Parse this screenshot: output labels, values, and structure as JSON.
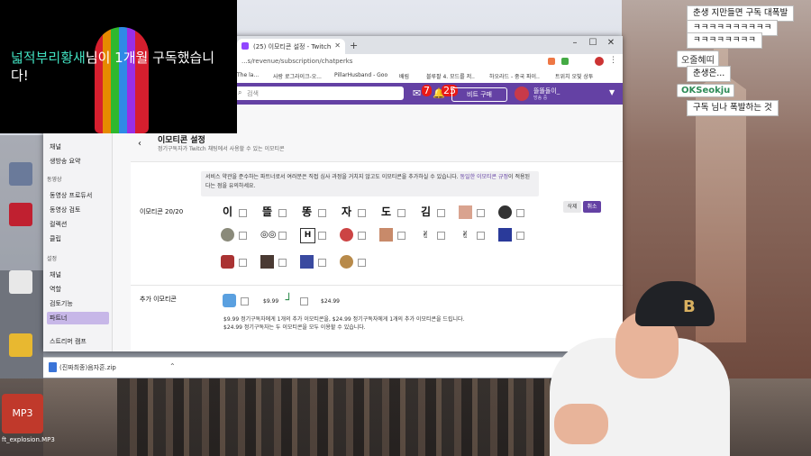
{
  "alert": {
    "name": "넓적부리황새",
    "message": "님이 1개월 구독했습니다!"
  },
  "browser": {
    "tab_title": "(25) 이모티콘 설정 - Twitch",
    "url": "...s/revenue/subscription/chatperks",
    "bookmarks": [
      "The la...",
      "사랑 로그라이크-오...",
      "PillarHusband - Goo",
      "배림",
      "블루팔 4. 모드를 저..",
      "하오라드 - 중국 파이..",
      "트위치 오빛 상투"
    ]
  },
  "twitch": {
    "search_placeholder": "검색",
    "notif_count_1": "7",
    "notif_count_2": "25",
    "bits_label": "비트 구매",
    "user_name": "뜰똘돌이_",
    "user_status": "방송 중"
  },
  "sidebar": {
    "items_top": [
      "채널",
      "생방송 요약"
    ],
    "section_video": "동영상",
    "items_video": [
      "동영상 프로듀서",
      "동영상 검토",
      "컬렉션",
      "클립"
    ],
    "section_settings": "설정",
    "items_settings": [
      "채널",
      "역할",
      "검토기능",
      "파트너"
    ],
    "footer": "스트리머 캠프"
  },
  "page": {
    "title": "이모티콘 설정",
    "subtitle": "정기구독자가 Twitch 채팅에서 사용할 수 있는 이모티콘",
    "notice_pre": "서비스 약관을 준수하는 파트너로서 여러분은 직접 심사 과정을 거치지 않고도 이모티콘을 추가하실 수 있습니다. ",
    "notice_link": "동일한 이모티콘 규정",
    "notice_post": "이 적용된다는 점을 유의하세요.",
    "emote_label": "이모티콘 20/20",
    "delete_label": "삭제",
    "cancel_label": "취소",
    "emotes_row1": [
      "이",
      "뜰",
      "똥",
      "자",
      "도",
      "김"
    ],
    "extra_label": "추가 이모티콘",
    "extra_price1": "$9.99",
    "extra_price2": "$24.99",
    "extra_desc1": "$9.99 정기구독자에게 1개의 추가 이모티콘을, $24.99 정기구독자에게 1개의 추가 이모티콘을 드립니다.",
    "extra_desc2": "$24.99 정기구독자는 두 이모티콘을 모두 이용할 수 있습니다."
  },
  "download": {
    "file_name": "(진짜최종)음자흔.zip"
  },
  "chat": [
    {
      "name": "",
      "message": "춘생 지만들면 구독 대폭발"
    },
    {
      "name": "",
      "message": "ㅋㅋㅋㅋㅋㅋㅋㅋㅋㅋ"
    },
    {
      "name": "",
      "message": "ㅋㅋㅋㅋㅋㅋㅋㅋ"
    },
    {
      "name": "오줄혜띠",
      "message": "춘생은..."
    },
    {
      "name": "OKSeokju",
      "message": "구독 님나 폭발하는 것"
    }
  ],
  "desktop": {
    "mp3_label": "MP3",
    "mp3_file": "ft_explosion.MP3"
  },
  "colors": {
    "twitch_purple": "#6441a4",
    "alert_name": "#41e0c0",
    "chat_name_green": "#2e8b57"
  }
}
